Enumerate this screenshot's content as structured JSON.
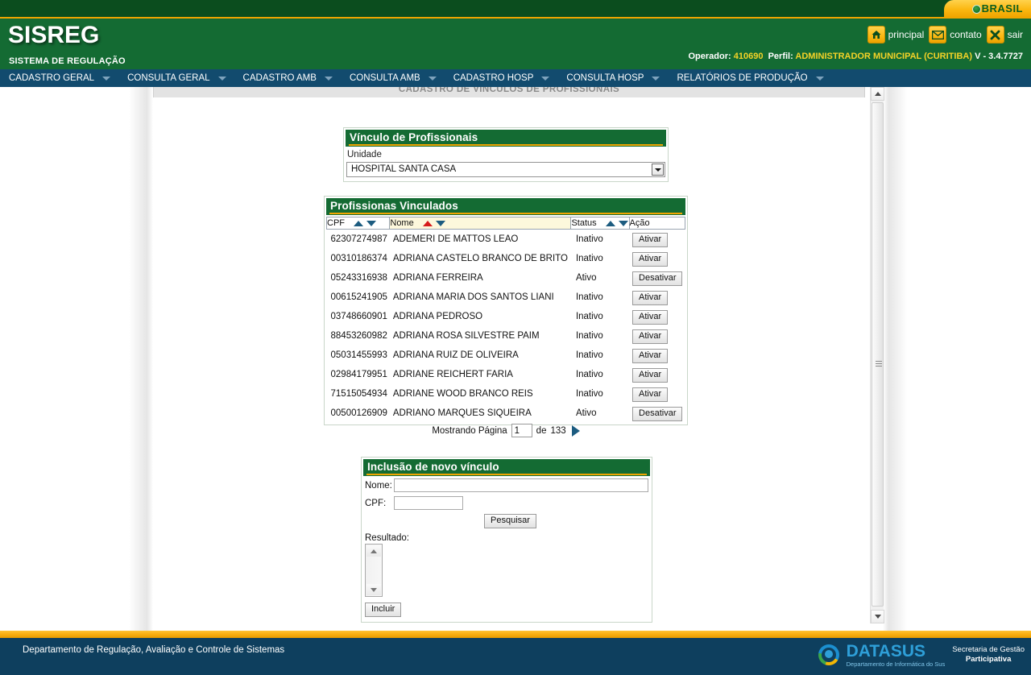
{
  "brasil": {
    "label": "BRASIL"
  },
  "header": {
    "logo": "SISREG",
    "subtitle": "SISTEMA DE REGULAÇÃO",
    "links": [
      {
        "label": "principal",
        "icon": "home-icon"
      },
      {
        "label": "contato",
        "icon": "envelope-icon"
      },
      {
        "label": "sair",
        "icon": "close-icon"
      }
    ],
    "operator_label": "Operador:",
    "operator_value": "410690",
    "profile_label": "Perfil:",
    "profile_value": "ADMINISTRADOR MUNICIPAL (CURITIBA)",
    "version": "V - 3.4.7727"
  },
  "nav": [
    {
      "label": "CADASTRO GERAL"
    },
    {
      "label": "CONSULTA GERAL"
    },
    {
      "label": "CADASTRO AMB"
    },
    {
      "label": "CONSULTA AMB"
    },
    {
      "label": "CADASTRO HOSP"
    },
    {
      "label": "CONSULTA HOSP"
    },
    {
      "label": "RELATÓRIOS DE PRODUÇÃO"
    }
  ],
  "page_title": "CADASTRO DE VÍNCULOS DE PROFISSIONAIS",
  "vinculo_panel": {
    "title": "Vínculo de Profissionais",
    "unidade_label": "Unidade",
    "unidade_value": "HOSPITAL SANTA CASA"
  },
  "profissionais_panel": {
    "title": "Profissionas Vinculados",
    "columns": [
      "CPF",
      "Nome",
      "Status",
      "Ação"
    ],
    "rows": [
      {
        "cpf": "62307274987",
        "nome": "ADEMERI DE MATTOS LEAO",
        "status": "Inativo",
        "action": "Ativar"
      },
      {
        "cpf": "00310186374",
        "nome": "ADRIANA CASTELO BRANCO DE BRITO",
        "status": "Inativo",
        "action": "Ativar"
      },
      {
        "cpf": "05243316938",
        "nome": "ADRIANA FERREIRA",
        "status": "Ativo",
        "action": "Desativar"
      },
      {
        "cpf": "00615241905",
        "nome": "ADRIANA MARIA DOS SANTOS LIANI",
        "status": "Inativo",
        "action": "Ativar"
      },
      {
        "cpf": "03748660901",
        "nome": "ADRIANA PEDROSO",
        "status": "Inativo",
        "action": "Ativar"
      },
      {
        "cpf": "88453260982",
        "nome": "ADRIANA ROSA SILVESTRE PAIM",
        "status": "Inativo",
        "action": "Ativar"
      },
      {
        "cpf": "05031455993",
        "nome": "ADRIANA RUIZ DE OLIVEIRA",
        "status": "Inativo",
        "action": "Ativar"
      },
      {
        "cpf": "02984179951",
        "nome": "ADRIANE REICHERT FARIA",
        "status": "Inativo",
        "action": "Ativar"
      },
      {
        "cpf": "71515054934",
        "nome": "ADRIANE WOOD BRANCO REIS",
        "status": "Inativo",
        "action": "Ativar"
      },
      {
        "cpf": "00500126909",
        "nome": "ADRIANO MARQUES SIQUEIRA",
        "status": "Ativo",
        "action": "Desativar"
      }
    ]
  },
  "pagination": {
    "prefix": "Mostrando Página",
    "current": "1",
    "middle": "de",
    "total": "133"
  },
  "inclusao_panel": {
    "title": "Inclusão de novo vínculo",
    "nome_label": "Nome:",
    "nome_value": "",
    "cpf_label": "CPF:",
    "cpf_value": "",
    "search_button": "Pesquisar",
    "resultado_label": "Resultado:",
    "incluir_button": "Incluir"
  },
  "footer": {
    "text": "Departamento de Regulação, Avaliação e Controle de Sistemas",
    "datasus_title": "DATASUS",
    "datasus_sub": "Departamento de Informática do Sus",
    "sgp_line1": "Secretaria de Gestão",
    "sgp_line2": "Participativa"
  }
}
